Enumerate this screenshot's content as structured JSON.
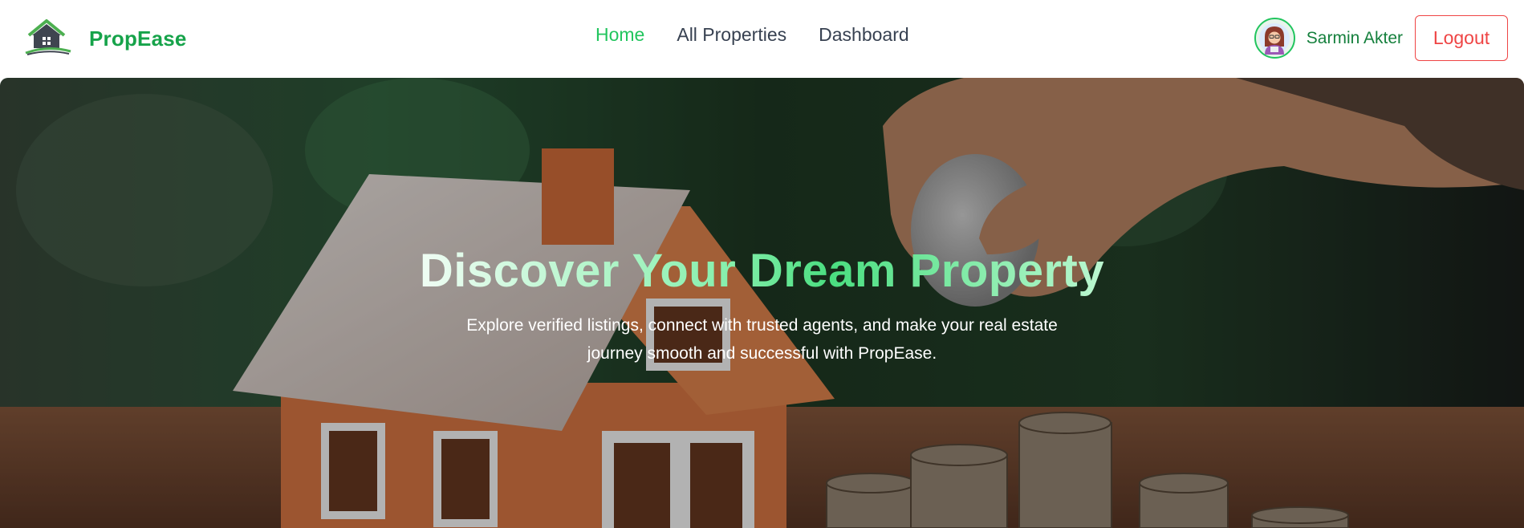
{
  "brand": {
    "name": "PropEase",
    "logo_icon": "house-logo-icon"
  },
  "nav": {
    "links": [
      {
        "label": "Home",
        "active": true
      },
      {
        "label": "All Properties",
        "active": false
      },
      {
        "label": "Dashboard",
        "active": false
      }
    ]
  },
  "user": {
    "name": "Sarmin Akter",
    "avatar_icon": "user-avatar-icon",
    "logout_label": "Logout"
  },
  "hero": {
    "title": "Discover Your Dream Property",
    "subtitle": "Explore verified listings, connect with trusted agents, and make your real estate journey smooth and successful with PropEase.",
    "image": "house-model-and-coins-photo"
  },
  "colors": {
    "brand_green": "#16a34a",
    "active_link": "#22c55e",
    "logout_red": "#ef4444",
    "nav_text": "#374151"
  }
}
